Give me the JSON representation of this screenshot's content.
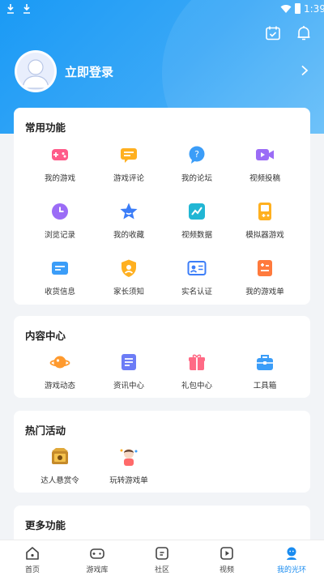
{
  "status_bar": {
    "time": "1:39"
  },
  "header": {
    "icons": [
      "calendar-check-icon",
      "bell-icon"
    ],
    "login_label": "立即登录"
  },
  "common_functions": {
    "title": "常用功能",
    "items": [
      {
        "label": "我的游戏",
        "icon": "gamepad-icon"
      },
      {
        "label": "游戏评论",
        "icon": "comment-icon"
      },
      {
        "label": "我的论坛",
        "icon": "question-bubble-icon"
      },
      {
        "label": "视频投稿",
        "icon": "video-camera-icon"
      },
      {
        "label": "浏览记录",
        "icon": "clock-icon"
      },
      {
        "label": "我的收藏",
        "icon": "star-icon"
      },
      {
        "label": "视频数据",
        "icon": "chart-icon"
      },
      {
        "label": "模拟器游戏",
        "icon": "emulator-icon"
      },
      {
        "label": "收货信息",
        "icon": "address-card-icon"
      },
      {
        "label": "家长须知",
        "icon": "shield-icon"
      },
      {
        "label": "实名认证",
        "icon": "id-card-icon"
      },
      {
        "label": "我的游戏单",
        "icon": "game-list-icon"
      }
    ]
  },
  "content_center": {
    "title": "内容中心",
    "items": [
      {
        "label": "游戏动态",
        "icon": "planet-icon"
      },
      {
        "label": "资讯中心",
        "icon": "news-icon"
      },
      {
        "label": "礼包中心",
        "icon": "gift-icon"
      },
      {
        "label": "工具箱",
        "icon": "toolbox-icon"
      }
    ]
  },
  "hot_activities": {
    "title": "热门活动",
    "items": [
      {
        "label": "达人悬赏令",
        "icon": "bounty-icon"
      },
      {
        "label": "玩转游戏单",
        "icon": "character-icon"
      }
    ]
  },
  "more_functions": {
    "title": "更多功能"
  },
  "tab_bar": {
    "tabs": [
      {
        "label": "首页",
        "icon": "home-icon"
      },
      {
        "label": "游戏库",
        "icon": "game-library-icon"
      },
      {
        "label": "社区",
        "icon": "community-icon"
      },
      {
        "label": "视频",
        "icon": "video-play-icon"
      },
      {
        "label": "我的光环",
        "icon": "profile-icon"
      }
    ],
    "active_index": 4
  },
  "colors": {
    "accent": "#1a8cf0",
    "header_gradient_start": "#1a9af5",
    "header_gradient_end": "#63bdf9",
    "background": "#f2f4f7"
  }
}
